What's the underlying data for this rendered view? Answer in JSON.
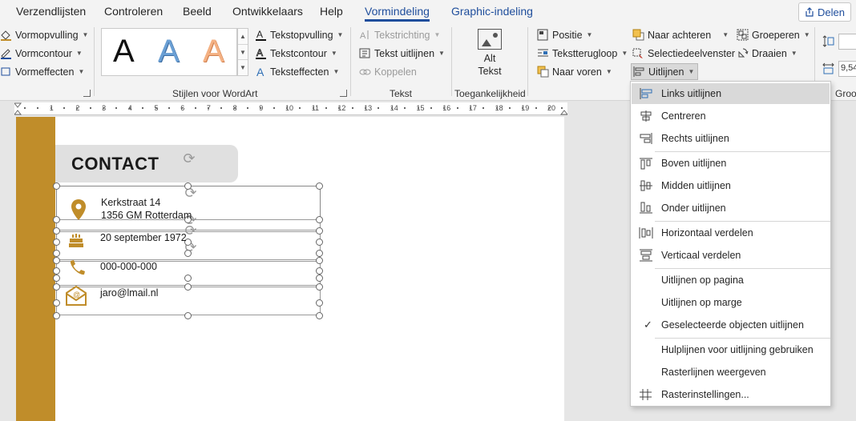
{
  "tabs": [
    {
      "label": "Verzendlijsten"
    },
    {
      "label": "Controleren"
    },
    {
      "label": "Beeld"
    },
    {
      "label": "Ontwikkelaars"
    },
    {
      "label": "Help"
    },
    {
      "label": "Vormindeling"
    },
    {
      "label": "Graphic-indeling"
    }
  ],
  "share_label": "Delen",
  "ribbon": {
    "shape_styles": {
      "fill": "Vormopvulling",
      "outline": "Vormcontour",
      "effects": "Vormeffecten"
    },
    "wordart": {
      "group_label": "Stijlen voor WordArt",
      "samples": [
        "A",
        "A",
        "A"
      ],
      "text_fill": "Tekstopvulling",
      "text_outline": "Tekstcontour",
      "text_effects": "Teksteffecten"
    },
    "text": {
      "group_label": "Tekst",
      "direction": "Tekstrichting",
      "align": "Tekst uitlijnen",
      "link": "Koppelen"
    },
    "accessibility": {
      "group_label": "Toegankelijkheid",
      "alt_text_line1": "Alt",
      "alt_text_line2": "Tekst"
    },
    "arrange": {
      "position": "Positie",
      "wrap": "Tekstterugloop",
      "forward": "Naar voren",
      "backward": "Naar achteren",
      "selection_pane": "Selectiedeelvenster",
      "align": "Uitlijnen",
      "group": "Groeperen",
      "rotate": "Draaien"
    },
    "size": {
      "group_label": "Groo",
      "width_value": "9,54"
    }
  },
  "ruler": {
    "numbers": [
      "1",
      "2",
      "3",
      "4",
      "5",
      "6",
      "7",
      "8",
      "9",
      "10",
      "11",
      "12",
      "13",
      "14",
      "15",
      "16",
      "17",
      "18",
      "19",
      "20"
    ]
  },
  "document": {
    "contact_title": "CONTACT",
    "address_line1": "Kerkstraat 14",
    "address_line2": "1356 GM Rotterdam",
    "birthday": "20 september 1972",
    "phone": "000-000-000",
    "email": "jaro@lmail.nl",
    "accent_color": "#c08d2a"
  },
  "align_menu": {
    "items": [
      {
        "label": "Links uitlijnen",
        "icon": "align-left-icon",
        "highlighted": true
      },
      {
        "label": "Centreren",
        "icon": "align-center-icon"
      },
      {
        "label": "Rechts uitlijnen",
        "icon": "align-right-icon"
      },
      {
        "label": "Boven uitlijnen",
        "icon": "align-top-icon"
      },
      {
        "label": "Midden uitlijnen",
        "icon": "align-middle-icon"
      },
      {
        "label": "Onder uitlijnen",
        "icon": "align-bottom-icon"
      },
      {
        "label": "Horizontaal verdelen",
        "icon": "distribute-horizontal-icon"
      },
      {
        "label": "Verticaal verdelen",
        "icon": "distribute-vertical-icon"
      },
      {
        "label": "Uitlijnen op pagina",
        "icon": ""
      },
      {
        "label": "Uitlijnen op marge",
        "icon": ""
      },
      {
        "label": "Geselecteerde objecten uitlijnen",
        "icon": "",
        "checked": true
      },
      {
        "label": "Hulplijnen voor uitlijning gebruiken",
        "icon": ""
      },
      {
        "label": "Rasterlijnen weergeven",
        "icon": ""
      },
      {
        "label": "Rasterinstellingen...",
        "icon": "grid-icon"
      }
    ]
  }
}
